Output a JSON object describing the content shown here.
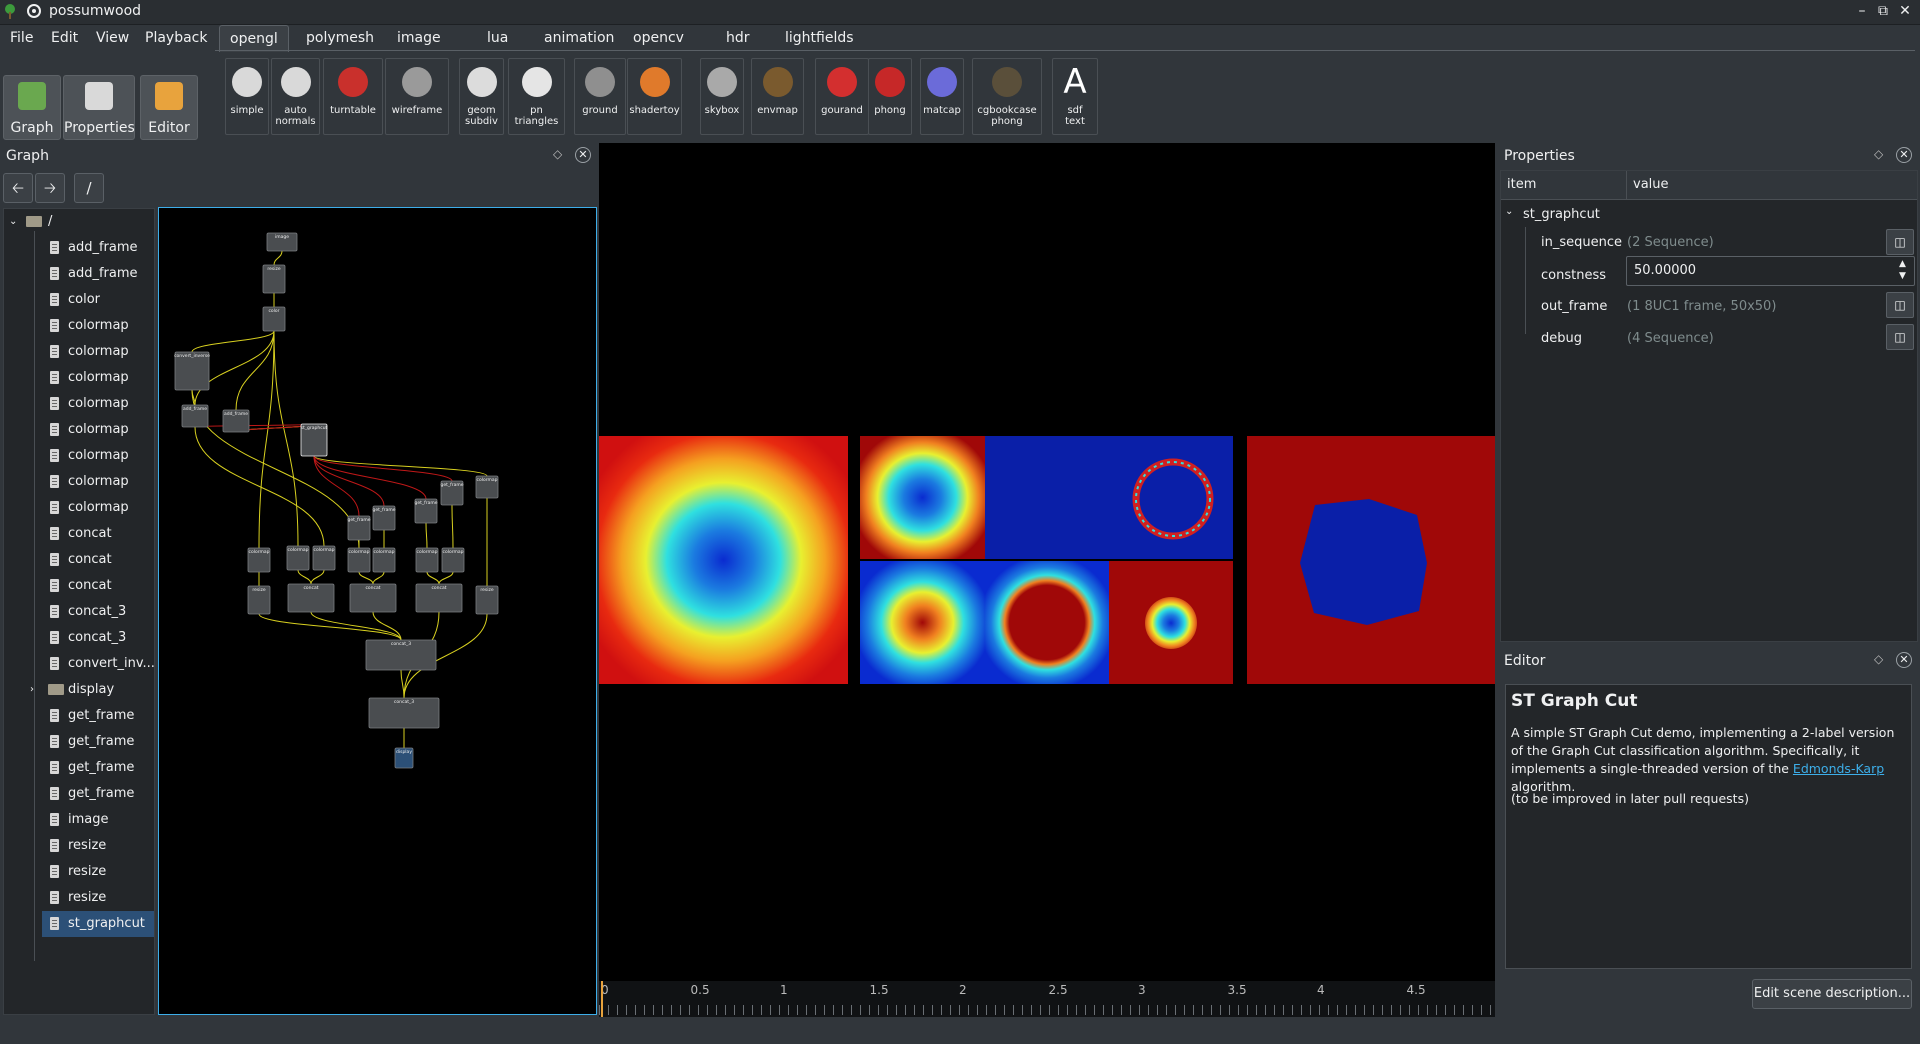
{
  "window": {
    "title": "possumwood"
  },
  "menu": [
    "File",
    "Edit",
    "View",
    "Playback"
  ],
  "toolbar_tabs": [
    "opengl",
    "polymesh",
    "image",
    "lua",
    "animation",
    "opencv",
    "hdr",
    "lightfields"
  ],
  "mode_buttons": [
    "Graph",
    "Properties",
    "Editor"
  ],
  "tools": [
    {
      "label": "simple",
      "icon": "teapot-icon",
      "color": "#d9d9d9"
    },
    {
      "label": "auto\nnormals",
      "icon": "teapot-icon",
      "color": "#d9d9d9"
    },
    {
      "label": "turntable",
      "icon": "car-icon",
      "color": "#c9302c"
    },
    {
      "label": "wireframe",
      "icon": "cube-icon",
      "color": "#9a9a9a"
    },
    {
      "label": "geom\nsubdiv",
      "icon": "shape-icon",
      "color": "#dcdcdc"
    },
    {
      "label": "pn\ntriangles",
      "icon": "cone-icon",
      "color": "#e5e5e5"
    },
    {
      "label": "ground",
      "icon": "ground-icon",
      "color": "#8f8f8f"
    },
    {
      "label": "shadertoy",
      "icon": "swirl-icon",
      "color": "#e07a2b"
    },
    {
      "label": "skybox",
      "icon": "sphere-icon",
      "color": "#a9a9a9"
    },
    {
      "label": "envmap",
      "icon": "teapot-icon",
      "color": "#7a5a2e"
    },
    {
      "label": "gourand",
      "icon": "teapot-icon",
      "color": "#d32f2f"
    },
    {
      "label": "phong",
      "icon": "teapot-icon",
      "color": "#c62828"
    },
    {
      "label": "matcap",
      "icon": "figure-icon",
      "color": "#6b6bd9"
    },
    {
      "label": "cgbookcase\nphong",
      "icon": "sphere-icon",
      "color": "#5a4f3a"
    },
    {
      "label": "sdf\ntext",
      "icon": "letter-a-icon",
      "color": "#ffffff"
    }
  ],
  "graph_panel": {
    "title": "Graph",
    "path": "/"
  },
  "tree": {
    "root": "/",
    "items": [
      "add_frame",
      "add_frame",
      "color",
      "colormap",
      "colormap",
      "colormap",
      "colormap",
      "colormap",
      "colormap",
      "colormap",
      "colormap",
      "concat",
      "concat",
      "concat",
      "concat_3",
      "concat_3",
      "convert_inv...",
      "display",
      "get_frame",
      "get_frame",
      "get_frame",
      "get_frame",
      "image",
      "resize",
      "resize",
      "resize",
      "st_graphcut"
    ],
    "folder_item": "display",
    "selected": "st_graphcut"
  },
  "properties": {
    "title": "Properties",
    "col_item": "item",
    "col_value": "value",
    "node": "st_graphcut",
    "rows": [
      {
        "name": "in_sequence",
        "value": "(2 Sequence)"
      },
      {
        "name": "constness",
        "value": "50.00000"
      },
      {
        "name": "out_frame",
        "value": "(1 8UC1 frame, 50x50)"
      },
      {
        "name": "debug",
        "value": "(4 Sequence)"
      }
    ]
  },
  "editor": {
    "title": "Editor",
    "heading": "ST Graph Cut",
    "para1_a": "A simple ST Graph Cut demo, implementing a 2-label version of the Graph Cut classification algorithm. Specifically, it implements a single-threaded version of the ",
    "para1_link": "Edmonds-Karp",
    "para1_b": " algorithm.",
    "para2": "(to be improved in later pull requests)",
    "button": "Edit scene description..."
  },
  "timeline": {
    "ticks": [
      "0",
      "0.5",
      "1",
      "1.5",
      "2",
      "2.5",
      "3",
      "3.5",
      "4",
      "4.5"
    ]
  },
  "graph_nodes": {
    "image": "image",
    "resize": "resize",
    "color": "color",
    "convert_inv": "convert_inverse",
    "add_frame": "add_frame",
    "st_graphcut": "st_graphcut",
    "colormap": "colormap",
    "get_frame": "get_frame",
    "concat": "concat",
    "concat_3": "concat_3",
    "display": "display"
  }
}
